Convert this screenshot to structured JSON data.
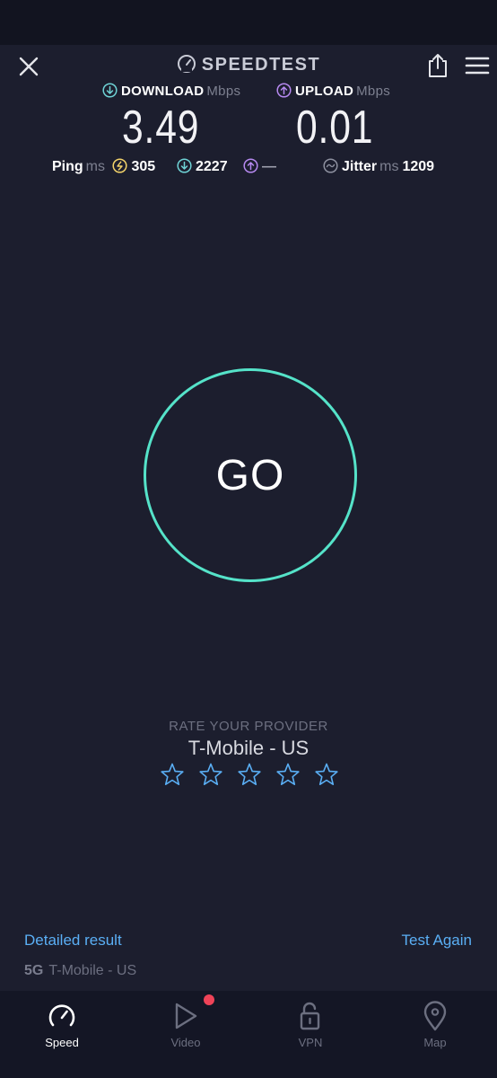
{
  "header": {
    "brand": "SPEEDTEST"
  },
  "download": {
    "label": "DOWNLOAD",
    "unit": "Mbps",
    "value": "3.49"
  },
  "upload": {
    "label": "UPLOAD",
    "unit": "Mbps",
    "value": "0.01"
  },
  "ping": {
    "label": "Ping",
    "unit": "ms",
    "idle": "305",
    "download": "2227",
    "upload": "—"
  },
  "jitter": {
    "label": "Jitter",
    "unit": "ms",
    "value": "1209"
  },
  "go_label": "GO",
  "rating": {
    "title": "RATE YOUR PROVIDER",
    "provider": "T-Mobile - US",
    "stars_total": 5,
    "stars_filled": 0
  },
  "footer": {
    "detailed_label": "Detailed result",
    "again_label": "Test Again",
    "network_type": "5G",
    "network_name": "T-Mobile - US"
  },
  "tabs": [
    {
      "label": "Speed",
      "icon": "speedometer-icon",
      "active": true
    },
    {
      "label": "Video",
      "icon": "play-icon",
      "active": false,
      "notification": true
    },
    {
      "label": "VPN",
      "icon": "lock-icon",
      "active": false
    },
    {
      "label": "Map",
      "icon": "map-pin-icon",
      "active": false
    }
  ],
  "colors": {
    "accent": "#55e3c9",
    "download": "#6fd3d6",
    "upload": "#b689f0",
    "link": "#5aaff5",
    "ping": "#f3d36a",
    "notification": "#ef4358"
  }
}
